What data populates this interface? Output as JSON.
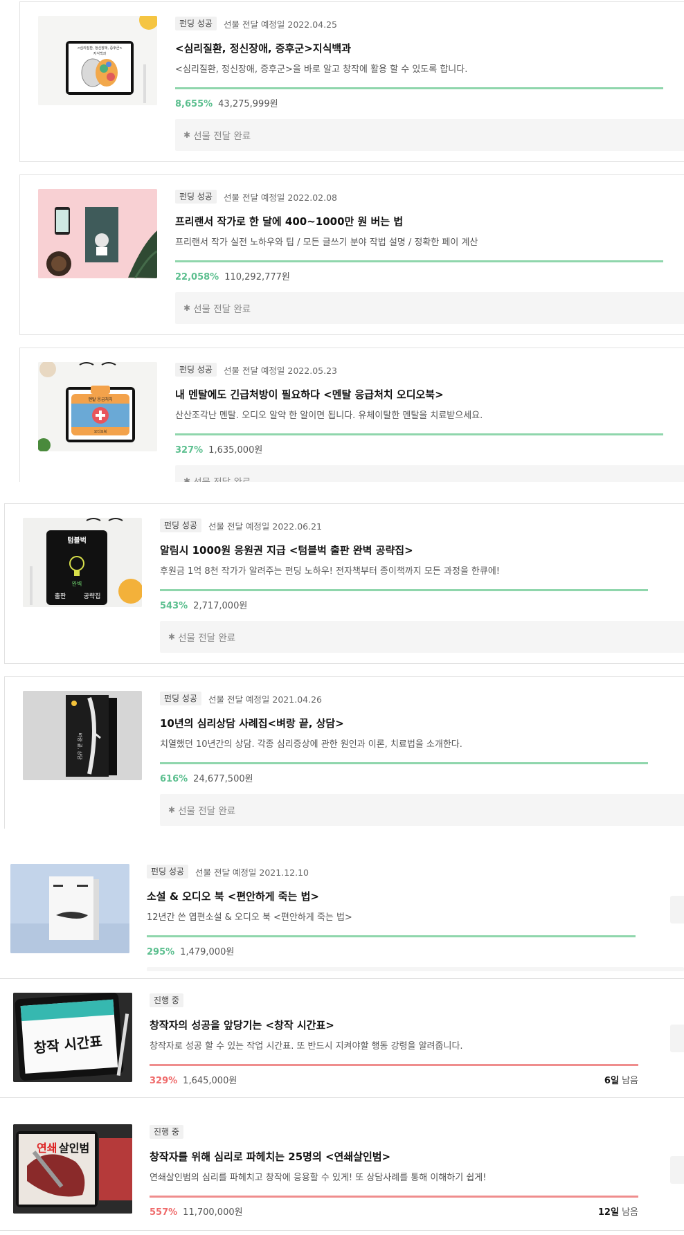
{
  "colors": {
    "success_green": "#5cbf8f",
    "bar_green": "#8fd6ac",
    "ongoing_red": "#ef6b6b",
    "bar_red": "#ef8d8d"
  },
  "projects": [
    {
      "status": "펀딩 성공",
      "delivery_date": "선물 전달 예정일 2022.04.25",
      "title": "<심리질환, 정신장애, 증후군>지식백과",
      "description": "<심리질환, 정신장애, 증후군>을 바로 알고 창작에 활용 할 수 있도록 합니다.",
      "percent": "8,655%",
      "amount": "43,275,999원",
      "delivery_status": "선물 전달 완료",
      "thumb_text": [
        "<심리질환, 정신장애, 증후군>",
        "지식백과"
      ]
    },
    {
      "status": "펀딩 성공",
      "delivery_date": "선물 전달 예정일 2022.02.08",
      "title": "프리랜서 작가로 한 달에 400~1000만 원 버는 법",
      "description": "프리랜서 작가 실전 노하우와 팁 / 모든 글쓰기 분야 작법 설명 / 정확한 페이 계산",
      "percent": "22,058%",
      "amount": "110,292,777원",
      "delivery_status": "선물 전달 완료"
    },
    {
      "status": "펀딩 성공",
      "delivery_date": "선물 전달 예정일 2022.05.23",
      "title": "내 멘탈에도 긴급처방이 필요하다 <멘탈 응급처치 오디오북>",
      "description": "산산조각난 멘탈. 오디오 알약 한 알이면 됩니다. 유체이탈한 멘탈을 치료받으세요.",
      "percent": "327%",
      "amount": "1,635,000원",
      "delivery_status": "선물 전달 완료",
      "thumb_text": [
        "멘탈 응급처치",
        "오디오북"
      ]
    },
    {
      "status": "펀딩 성공",
      "delivery_date": "선물 전달 예정일 2022.06.21",
      "title": "알림시 1000원 응원권 지급 <텀블벅 출판 완벽 공략집>",
      "description": "후원금 1억 8천 작가가 알려주는 펀딩 노하우! 전자책부터 종이책까지 모든 과정을 한큐에!",
      "percent": "543%",
      "amount": "2,717,000원",
      "delivery_status": "선물 전달 완료",
      "thumb_text": [
        "텀블벅",
        "완벽",
        "출판",
        "공략집"
      ]
    },
    {
      "status": "펀딩 성공",
      "delivery_date": "선물 전달 예정일 2021.04.26",
      "title": "10년의 심리상담 사례집<벼랑 끝, 상담>",
      "description": "치열했던 10년간의 상담. 각종 심리증상에 관한 원인과 이론, 치료법을 소개한다.",
      "percent": "616%",
      "amount": "24,677,500원",
      "delivery_status": "선물 전달 완료",
      "thumb_text": [
        "벼랑 끝, 상담"
      ]
    },
    {
      "status": "펀딩 성공",
      "delivery_date": "선물 전달 예정일 2021.12.10",
      "title": "소설 & 오디오 북 <편안하게 죽는 법>",
      "description": "12년간 쓴 엽편소설 & 오디오 북 <편안하게 죽는 법>",
      "percent": "295%",
      "amount": "1,479,000원"
    },
    {
      "status": "진행 중",
      "title": "창작자의 성공을 앞당기는 <창작 시간표>",
      "description": "창작자로 성공 할 수 있는 작업 시간표. 또 반드시 지켜야할 행동 강령을 알려줍니다.",
      "percent": "329%",
      "amount": "1,645,000원",
      "remain_days": "6일",
      "remain_suffix": "남음",
      "thumb_text": [
        "창작 시간표"
      ]
    },
    {
      "status": "진행 중",
      "title": "창작자를 위해 심리로 파헤치는 25명의 <연쇄살인범>",
      "description": "연쇄살인범의 심리를 파헤치고 창작에 응용할 수 있게! 또 상담사례를 통해 이해하기 쉽게!",
      "percent": "557%",
      "amount": "11,700,000원",
      "remain_days": "12일",
      "remain_suffix": "남음",
      "thumb_text": [
        "연쇄",
        "살인범"
      ]
    }
  ]
}
